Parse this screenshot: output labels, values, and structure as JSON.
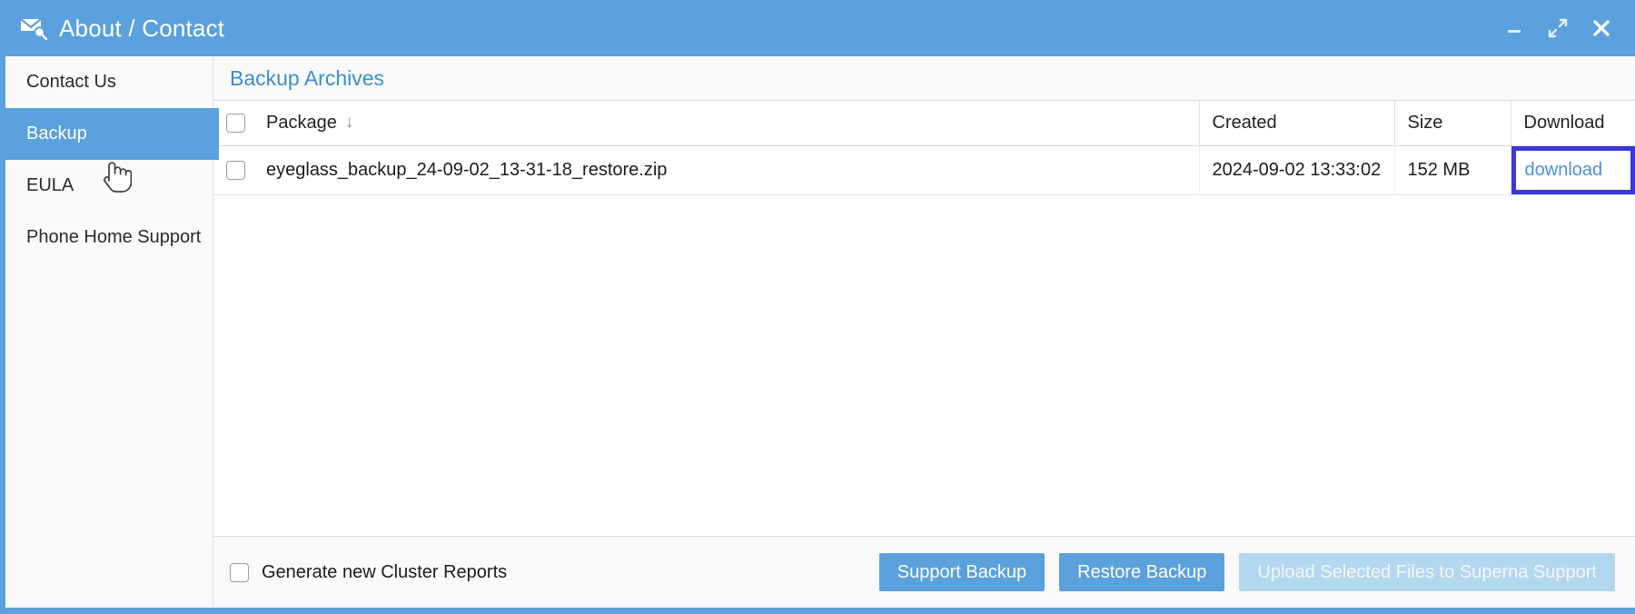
{
  "titlebar": {
    "icon": "mail-search-icon",
    "title": "About / Contact",
    "controls": [
      {
        "name": "minimize-button",
        "icon": "minimize-icon"
      },
      {
        "name": "maximize-button",
        "icon": "maximize-expand-icon"
      },
      {
        "name": "close-button",
        "icon": "close-icon"
      }
    ],
    "bg_color": "#5AA1DD"
  },
  "sidebar": {
    "items": [
      {
        "label": "Contact Us",
        "selected": false
      },
      {
        "label": "Backup",
        "selected": true
      },
      {
        "label": "EULA",
        "selected": false
      },
      {
        "label": "Phone Home Support",
        "selected": false
      }
    ],
    "selected_color": "#5AA1DD",
    "cursor": "pointing-hand-cursor"
  },
  "main": {
    "section_title": "Backup Archives",
    "section_title_color": "#3b8ed0",
    "table": {
      "columns": [
        {
          "key": "check",
          "label": ""
        },
        {
          "key": "package",
          "label": "Package",
          "sort": "descending",
          "sort_glyph": "↓"
        },
        {
          "key": "created",
          "label": "Created"
        },
        {
          "key": "size",
          "label": "Size"
        },
        {
          "key": "download",
          "label": "Download"
        }
      ],
      "select_all_checked": false,
      "rows": [
        {
          "checked": false,
          "package": "eyeglass_backup_24-09-02_13-31-18_restore.zip",
          "created": "2024-09-02 13:33:02",
          "size": "152 MB",
          "download_label": "download",
          "download_highlighted": true,
          "download_highlight_color": "#3b38d6",
          "download_link_color": "#4a90e2"
        }
      ]
    }
  },
  "footer": {
    "generate_reports": {
      "label": "Generate new Cluster Reports",
      "checked": false
    },
    "buttons": [
      {
        "label": "Support Backup",
        "disabled": false
      },
      {
        "label": "Restore Backup",
        "disabled": false
      },
      {
        "label": "Upload Selected Files to Superna Support",
        "disabled": true
      }
    ],
    "button_color": "#5AA1DD",
    "button_disabled_color": "#b4d7f0"
  }
}
